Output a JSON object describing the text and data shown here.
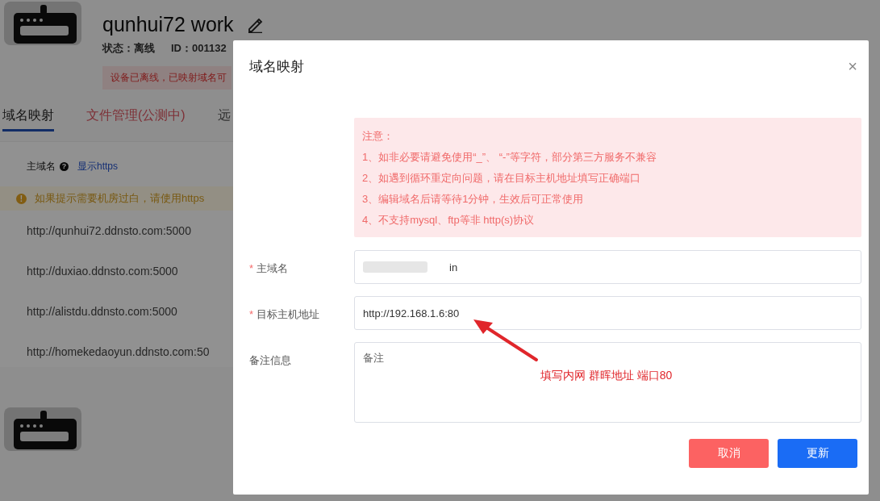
{
  "device": {
    "title": "qunhui72 work",
    "status": "状态：离线",
    "id": "ID：001132",
    "alert": "设备已离线，已映射域名可"
  },
  "tabs": [
    {
      "label": "域名映射",
      "selected": true,
      "kind": "plain"
    },
    {
      "label": "文件管理(公测中)",
      "selected": false,
      "kind": "beta"
    },
    {
      "label": "远",
      "selected": false,
      "kind": "plain"
    }
  ],
  "domain_card": {
    "header_label": "主域名",
    "help_icon": "?",
    "toggle_link": "显示https",
    "warning_icon": "!",
    "warning": "如果提示需要机房过白，请使用https",
    "domains": [
      "http://qunhui72.ddnsto.com:5000",
      "http://duxiao.ddnsto.com:5000",
      "http://alistdu.ddnsto.com:5000",
      "http://homekedaoyun.ddnsto.com:50"
    ]
  },
  "dialog": {
    "title": "域名映射",
    "close": "×",
    "required_mark": "*",
    "notice": [
      "注意：",
      "1、如非必要请避免使用“_”、 “-”等字符，部分第三方服务不兼容",
      "2、如遇到循环重定向问题，请在目标主机地址填写正确端口",
      "3、编辑域名后请等待1分钟，生效后可正常使用",
      "4、不支持mysql、ftp等非 http(s)协议"
    ],
    "fields": [
      {
        "label": "主域名",
        "required": true,
        "kind": "input",
        "value": "in"
      },
      {
        "label": "目标主机地址",
        "required": true,
        "kind": "input",
        "value": "http://192.168.1.6:80"
      },
      {
        "label": "备注信息",
        "required": false,
        "kind": "textarea",
        "placeholder": "备注"
      }
    ],
    "buttons": [
      {
        "label": "取消",
        "kind": "cancel"
      },
      {
        "label": "更新",
        "kind": "primary"
      }
    ]
  },
  "annotation": {
    "text": "填写内网 群晖地址 端口80"
  }
}
